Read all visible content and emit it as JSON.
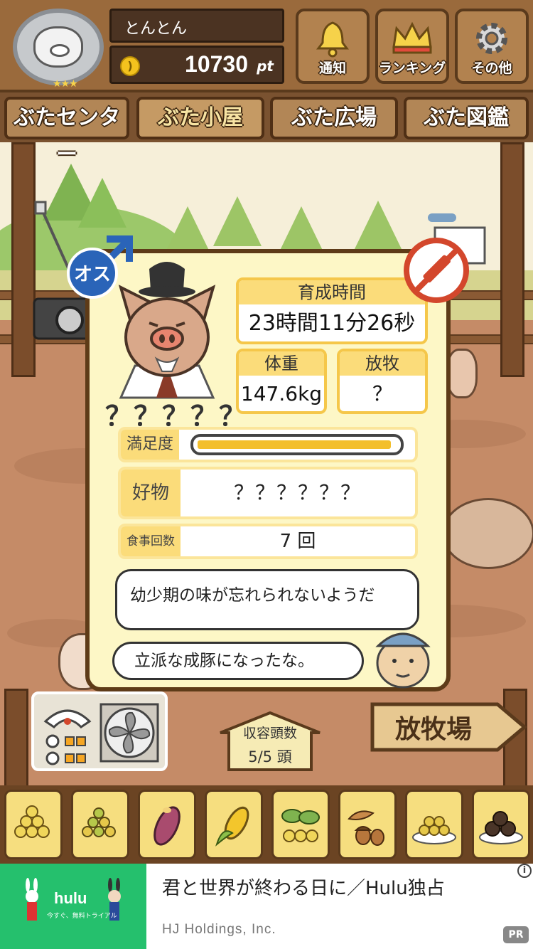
{
  "header": {
    "player_name": "とんとん",
    "points": "10730",
    "points_unit": "pt",
    "rank_stars": "★★★",
    "buttons": [
      {
        "label": "通知",
        "icon": "bell-icon"
      },
      {
        "label": "ランキング",
        "icon": "crown-icon"
      },
      {
        "label": "その他",
        "icon": "gear-icon"
      }
    ]
  },
  "tabs": [
    {
      "label": "ぶたセンター"
    },
    {
      "label": "ぶた小屋",
      "active": true
    },
    {
      "label": "ぶた広場"
    },
    {
      "label": "ぶた図鑑"
    }
  ],
  "pig": {
    "gender": "オス",
    "name": "？？？？？",
    "raising_time_label": "育成時間",
    "raising_time": "23時間11分26秒",
    "weight_label": "体重",
    "weight": "147.6kg",
    "grazing_label": "放牧",
    "grazing": "？",
    "satisfaction_label": "満足度",
    "satisfaction": 0.97,
    "favorite_label": "好物",
    "favorite": "？？？？？？",
    "meals_label": "食事回数",
    "meals": "7 回"
  },
  "dialogue": {
    "hint": "幼少期の味が忘れられないようだ",
    "comment": "立派な成豚になったな。"
  },
  "bottom": {
    "capacity_label": "収容頭数",
    "capacity_value": "5/5 頭",
    "ranch_sign": "放牧場"
  },
  "feeds": [
    {
      "icon": "soybeans-icon"
    },
    {
      "icon": "mixed-grain-icon"
    },
    {
      "icon": "sweet-potato-icon"
    },
    {
      "icon": "corn-icon"
    },
    {
      "icon": "herb-berries-icon"
    },
    {
      "icon": "acorn-icon"
    },
    {
      "icon": "grain-plate-icon"
    },
    {
      "icon": "truffle-plate-icon"
    }
  ],
  "ad": {
    "brand": "hulu",
    "brand_sub": "今すぐ、無料トライアル",
    "title": "君と世界が終わる日に／Hulu独占",
    "sponsor": "HJ Holdings, Inc.",
    "info": "i",
    "pr": "PR"
  },
  "colors": {
    "wood_dark": "#5a3a1c",
    "wood": "#b2824f",
    "card_bg": "#fdf7c6",
    "label_yellow": "#fbdc7a",
    "satisfaction_bar": "#f3bf2c",
    "gender_blue": "#2a64b8",
    "vaccine_red": "#d3472c",
    "ad_green": "#25c06d"
  }
}
